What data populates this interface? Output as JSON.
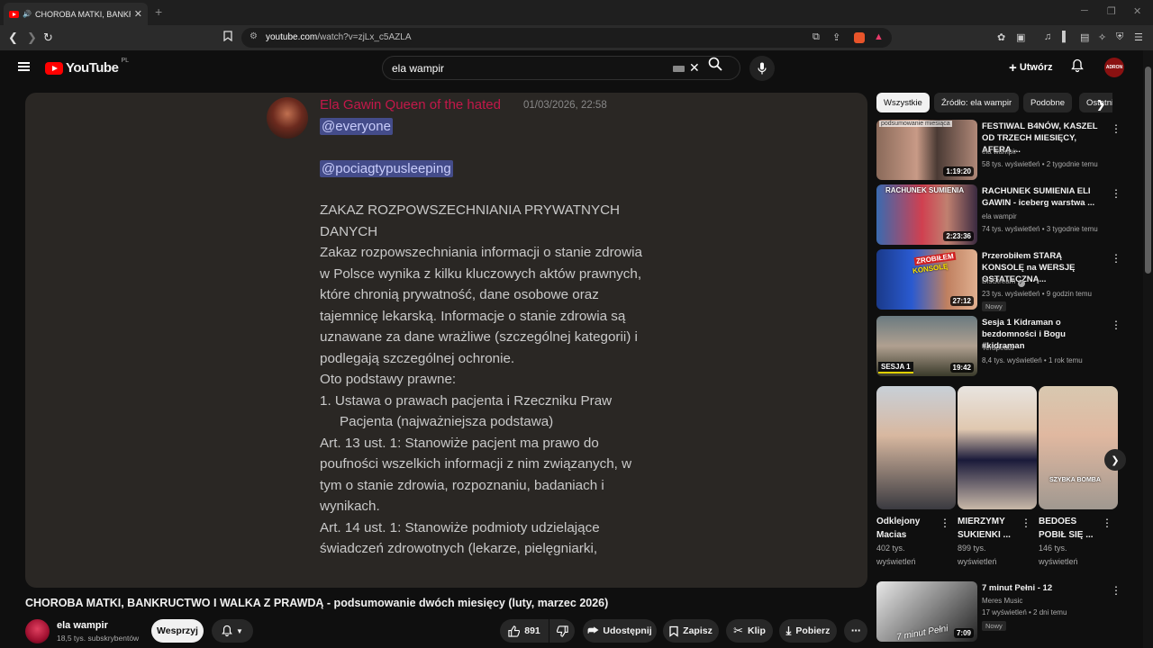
{
  "browser": {
    "tab_title": "CHOROBA MATKI, BANKRUC",
    "tab_close": "✕",
    "new_tab": "+",
    "url_domain": "youtube.com",
    "url_path": "/watch?v=zjLx_c5AZLA"
  },
  "header": {
    "logo_text": "YouTube",
    "logo_country": "PL",
    "search_value": "ela wampir",
    "create_label": "Utwórz",
    "account_initials": "ADRON"
  },
  "player": {
    "author": "Ela Gawin Queen of the hated",
    "timestamp": "01/03/2026, 22:58",
    "mention1": "@everyone",
    "mention2": "@pociagtypusleeping",
    "lines": [
      "ZAKAZ ROZPOWSZECHNIANIA PRYWATNYCH DANYCH",
      "Zakaz rozpowszechniania informacji o stanie zdrowia w Polsce wynika z kilku kluczowych aktów prawnych, które chronią prywatność, dane osobowe oraz tajemnicę lekarską. Informacje o stanie zdrowia są uznawane za dane wrażliwe (szczególnej kategorii) i podlegają szczególnej ochronie.",
      "Oto podstawy prawne:",
      "1.  Ustawa o prawach pacjenta i Rzeczniku Praw Pacjenta (najważniejsza podstawa)",
      "Art. 13 ust. 1: Stanowiże pacjent ma prawo do poufności wszelkich informacji z nim związanych, w tym o stanie zdrowia, rozpoznaniu, badaniach i wynikach.",
      "Art. 14 ust. 1: Stanowiże podmioty udzielające świadczeń zdrowotnych (lekarze, pielęgniarki,"
    ]
  },
  "video": {
    "title": "CHOROBA MATKI, BANKRUCTWO I WALKA Z PRAWDĄ - podsumowanie dwóch miesięcy (luty, marzec 2026)",
    "channel": "ela wampir",
    "subscribers": "18,5 tys. subskrybentów",
    "support_label": "Wesprzyj",
    "likes": "891",
    "share_label": "Udostępnij",
    "save_label": "Zapisz",
    "clip_label": "Klip",
    "download_label": "Pobierz"
  },
  "chips": [
    "Wszystkie",
    "Źródło: ela wampir",
    "Podobne",
    "Ostatnio przesłane"
  ],
  "recommendations": [
    {
      "title": "FESTIWAL B4NÓW, KASZEL OD TRZECH MIESIĘCY, AFERA ...",
      "channel": "ela wampir",
      "meta": "58 tys. wyświetleń • 2 tygodnie temu",
      "duration": "1:19:20",
      "badge": ""
    },
    {
      "title": "RACHUNEK SUMIENIA ELI GAWIN - iceberg warstwa ...",
      "channel": "ela wampir",
      "meta": "74 tys. wyświetleń • 3 tygodnie temu",
      "duration": "2:23:36",
      "badge": ""
    },
    {
      "title": "Przerobiłem STARĄ KONSOLĘ na WERSJĘ OSTATECZNĄ...",
      "channel": "DisStream",
      "meta": "23 tys. wyświetleń • 9 godzin temu",
      "duration": "27:12",
      "badge": "Nowy"
    },
    {
      "title": "Sesja 1 Kidraman o bezdomności i Bogu #kidraman",
      "channel": "Terapeuta",
      "meta": "8,4 tys. wyświetleń • 1 rok temu",
      "duration": "19:42",
      "badge": ""
    }
  ],
  "thumb_texts": {
    "t1": "podsumowanie miesiąca",
    "t2": "RACHUNEK SUMIENIA",
    "t3a": "ZROBIŁEM",
    "t3b": "KONSOLĘ",
    "t4": "SESJA 1",
    "s3": "SZYBKA BOMBA",
    "r5": "7 minut Pełni"
  },
  "shorts": [
    {
      "title": "Odklejony Macias",
      "views": "402 tys. wyświetleń"
    },
    {
      "title": "MIERZYMY SUKIENKI ...",
      "views": "899 tys. wyświetleń"
    },
    {
      "title": "BEDOES POBIŁ SIĘ ...",
      "views": "146 tys. wyświetleń"
    }
  ],
  "rec5": {
    "title": "7 minut Pełni - 12",
    "channel": "Meres Music",
    "meta": "17 wyświetleń • 2 dni temu",
    "duration": "7:09",
    "badge": "Nowy"
  },
  "colors": {
    "author": "#c3184a",
    "mention_bg": "#444c8a",
    "youtube_red": "#ff0000"
  }
}
